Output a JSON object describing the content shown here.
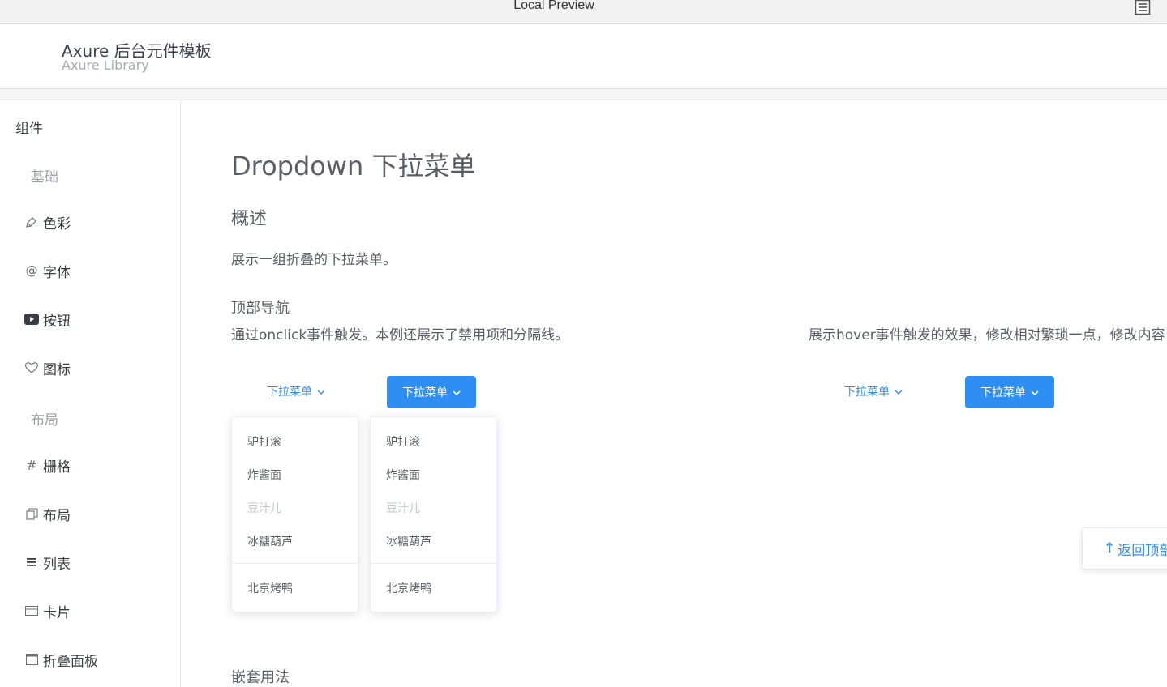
{
  "window": {
    "title": "Local Preview"
  },
  "header": {
    "title": "Axure 后台元件模板",
    "subtitle": "Axure Library"
  },
  "sidebar": {
    "section": "组件",
    "groups": [
      "基础",
      "布局"
    ],
    "items": [
      {
        "label": "色彩",
        "icon": "brush-icon"
      },
      {
        "label": "字体",
        "icon": "at-icon"
      },
      {
        "label": "按钮",
        "icon": "play-button-icon"
      },
      {
        "label": "图标",
        "icon": "heart-icon"
      },
      {
        "label": "栅格",
        "icon": "grid-hash-icon"
      },
      {
        "label": "布局",
        "icon": "copy-layout-icon"
      },
      {
        "label": "列表",
        "icon": "list-icon"
      },
      {
        "label": "卡片",
        "icon": "card-icon"
      },
      {
        "label": "折叠面板",
        "icon": "collapse-panel-icon"
      }
    ]
  },
  "main": {
    "title": "Dropdown 下拉菜单",
    "overview_heading": "概述",
    "overview_text": "展示一组折叠的下拉菜单。",
    "topnav_heading": "顶部导航",
    "left_desc": "通过onclick事件触发。本例还展示了禁用项和分隔线。",
    "right_desc": "展示hover事件触发的效果，修改相对繁琐一点，修改内容",
    "nested_heading": "嵌套用法",
    "dropdown_label": "下拉菜单",
    "chevron": "⌄",
    "menu_items": [
      "驴打滚",
      "炸酱面",
      "豆汁儿",
      "冰糖葫芦",
      "北京烤鸭"
    ],
    "disabled_item": "豆汁儿"
  },
  "backtop": {
    "label": "返回顶部",
    "arrow": "↑"
  },
  "colors": {
    "primary": "#2e8ef3",
    "text": "#5a5e66",
    "disabled": "#c0c4cc"
  }
}
